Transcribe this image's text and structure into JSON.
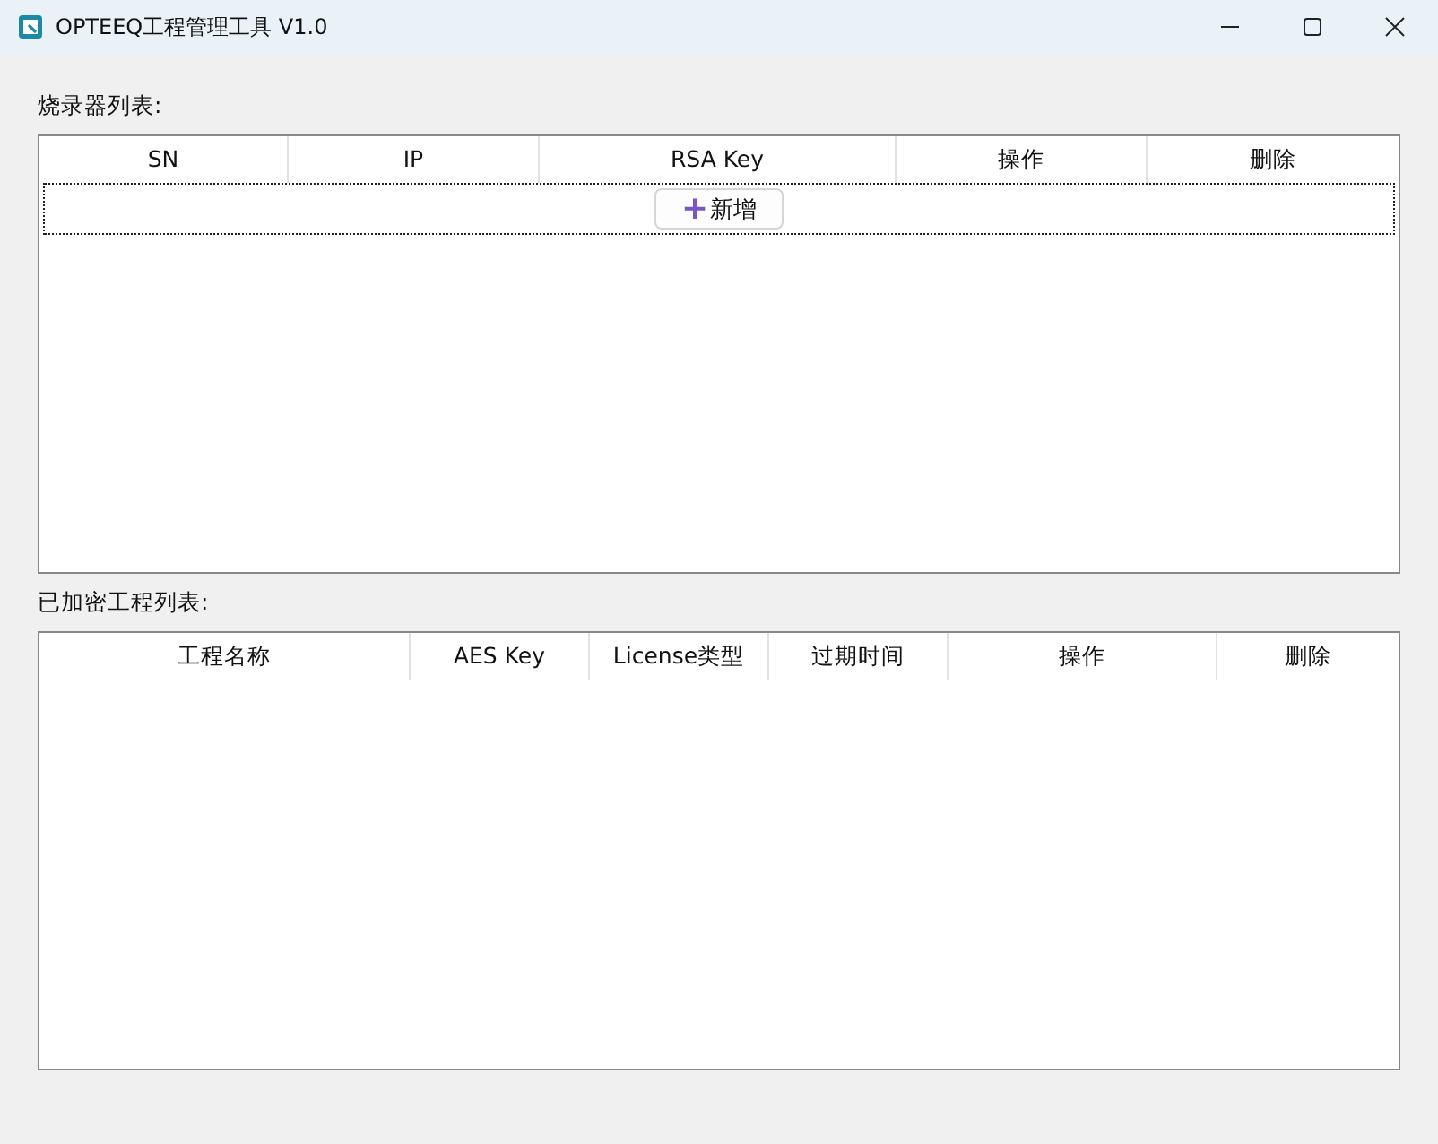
{
  "window": {
    "title": "OPTEEQ工程管理工具 V1.0"
  },
  "programmer_table": {
    "label": "烧录器列表:",
    "columns": [
      "SN",
      "IP",
      "RSA Key",
      "操作",
      "删除"
    ],
    "add_button": {
      "icon": "+",
      "label": "新增"
    }
  },
  "project_table": {
    "label": "已加密工程列表:",
    "columns": [
      "工程名称",
      "AES Key",
      "License类型",
      "过期时间",
      "操作",
      "删除"
    ]
  }
}
